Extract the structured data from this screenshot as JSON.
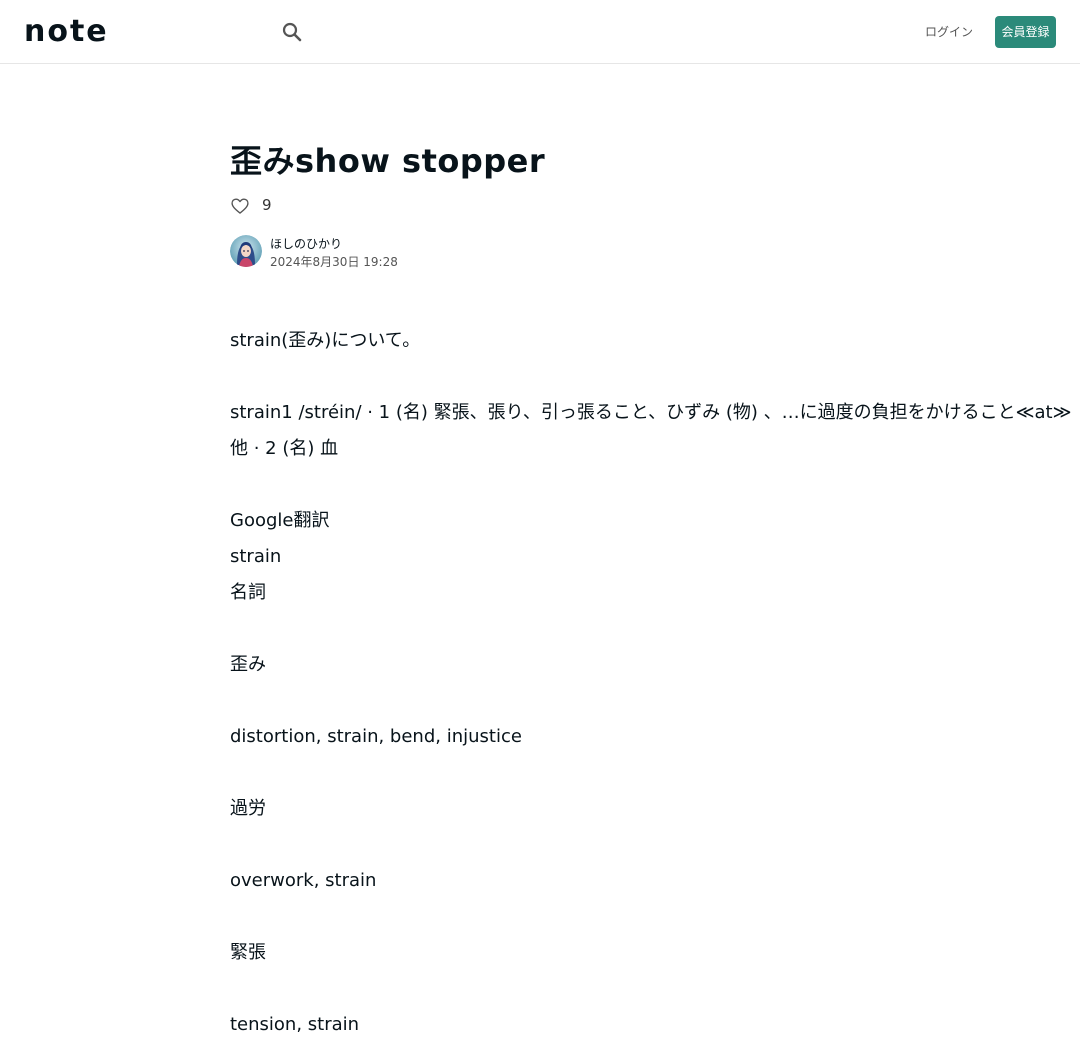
{
  "header": {
    "logo": "note",
    "login_label": "ログイン",
    "signup_label": "会員登録"
  },
  "colors": {
    "accent": "#2b8a7a",
    "text": "#08131a",
    "border": "#e6e6e6"
  },
  "article": {
    "title": "歪みshow stopper",
    "like_count": "9",
    "author": "ほしのひかり",
    "date": "2024年8月30日 19:28",
    "paragraphs": [
      "strain(歪み)について。",
      "",
      "strain1 /stréin/ · 1 (名) 緊張、張り、引っ張ること、ひずみ (物) 、…に過度の負担をかけること≪at≫",
      "他 · 2 (名) 血",
      "",
      "Google翻訳",
      "strain",
      "名詞",
      "",
      "歪み",
      "",
      "distortion, strain, bend, injustice",
      "",
      "過労",
      "",
      "overwork, strain",
      "",
      "緊張",
      "",
      "tension, strain"
    ]
  },
  "icons": {
    "search": "search-icon",
    "like": "heart-icon"
  }
}
